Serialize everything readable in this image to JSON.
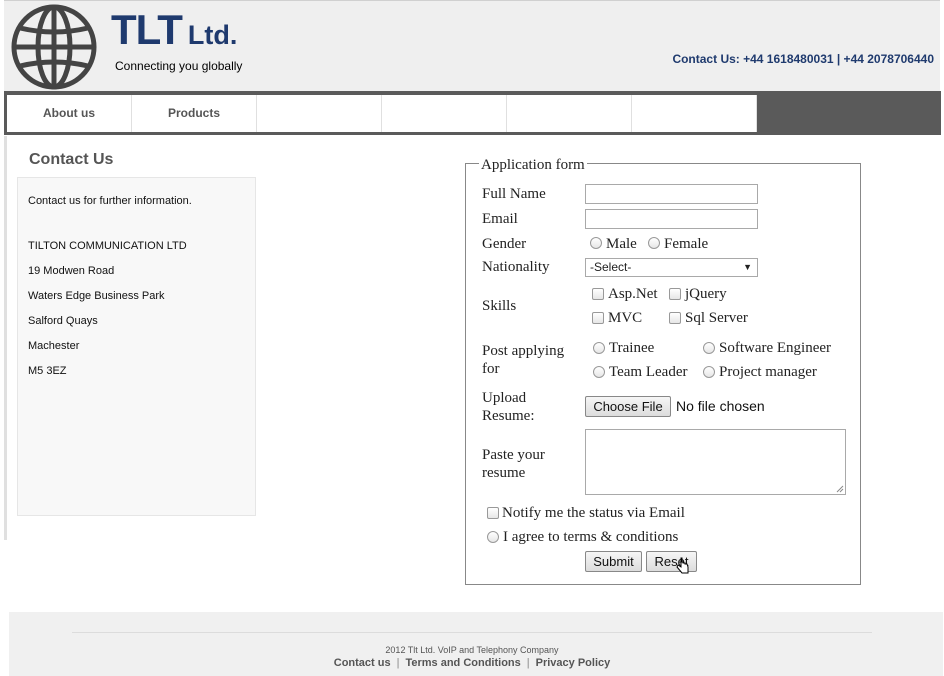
{
  "header": {
    "brand_main": "TLT",
    "brand_suffix": "Ltd.",
    "tagline": "Connecting you globally",
    "contact": "Contact Us: +44 1618480031 | +44 2078706440",
    "logo_icon": "globe-icon"
  },
  "nav": {
    "items": [
      "About us",
      "Products",
      "",
      "",
      "",
      ""
    ]
  },
  "contact": {
    "title": "Contact Us",
    "intro": "Contact us for further information.",
    "address": [
      "TILTON COMMUNICATION LTD",
      "19 Modwen Road",
      "Waters Edge Business Park",
      "Salford Quays",
      "Machester",
      "M5 3EZ"
    ]
  },
  "form": {
    "legend": "Application form",
    "full_name_label": "Full Name",
    "full_name_value": "",
    "email_label": "Email",
    "email_value": "",
    "gender_label": "Gender",
    "gender_options": [
      "Male",
      "Female"
    ],
    "nationality_label": "Nationality",
    "nationality_selected": "-Select-",
    "skills_label": "Skills",
    "skills": [
      "Asp.Net",
      "jQuery",
      "MVC",
      "Sql Server"
    ],
    "post_label_1": "Post applying",
    "post_label_2": "for",
    "posts": [
      "Trainee",
      "Software Engineer",
      "Team Leader",
      "Project manager"
    ],
    "upload_label_1": "Upload",
    "upload_label_2": "Resume:",
    "choose_file": "Choose File",
    "no_file": "No file chosen",
    "paste_label_1": "Paste your",
    "paste_label_2": "resume",
    "resume_value": "",
    "notify": "Notify me the status via Email",
    "agree": "I agree to terms & conditions",
    "submit": "Submit",
    "reset": "Reset"
  },
  "footer": {
    "copyright": "2012 Tlt Ltd. VoIP and Telephony Company",
    "links": [
      "Contact us",
      "Terms and Conditions",
      "Privacy Policy"
    ],
    "separator": "|"
  },
  "colors": {
    "brand": "#1f3a6e",
    "nav_bg": "#5a5a5a"
  }
}
